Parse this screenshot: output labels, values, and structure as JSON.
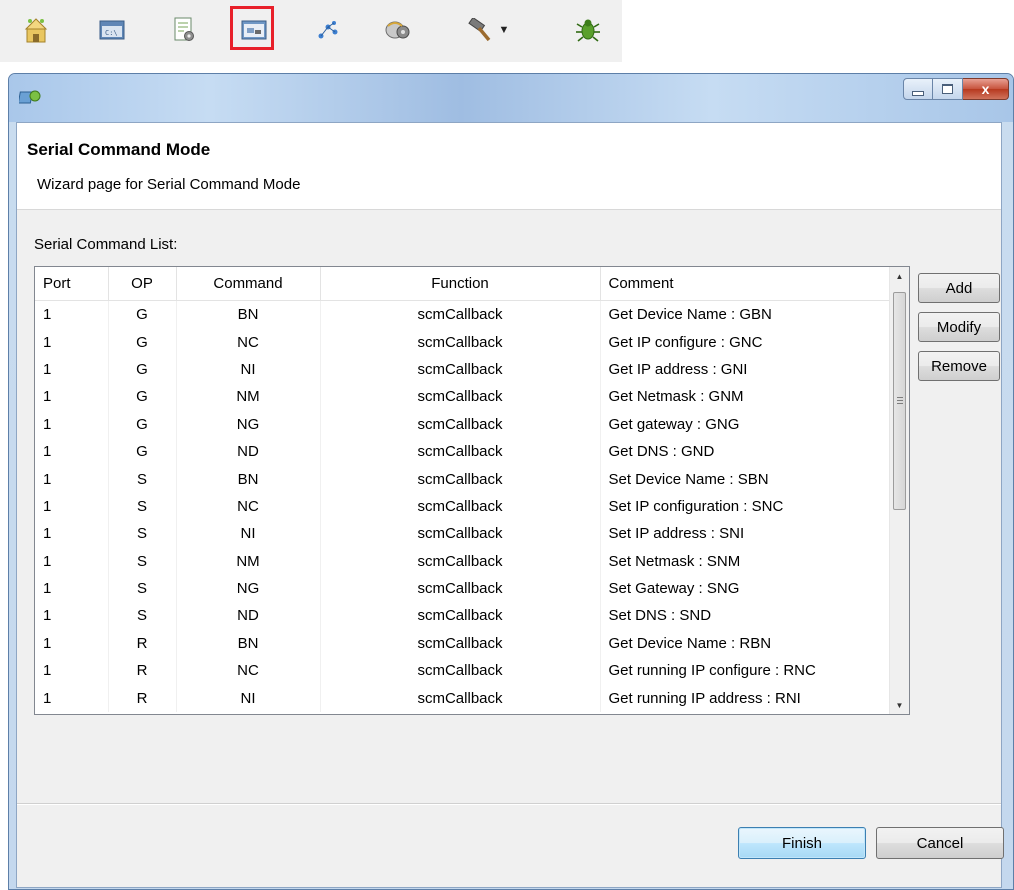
{
  "toolbar": {
    "buttons": [
      {
        "icon": "project-wizard-icon"
      },
      {
        "icon": "console-icon"
      },
      {
        "icon": "settings-document-icon"
      },
      {
        "icon": "serial-command-mode-icon",
        "selected": true
      },
      {
        "icon": "network-icon"
      },
      {
        "icon": "configure-icon"
      },
      {
        "icon": "build-hammer-icon"
      },
      {
        "icon": "debug-bug-icon"
      }
    ],
    "highlight_color": "#e8202a"
  },
  "window": {
    "caption": {
      "minimize": "–",
      "maximize": "□",
      "close": "x"
    }
  },
  "wizard": {
    "title": "Serial Command Mode",
    "description": "Wizard page for Serial Command Mode",
    "list_label": "Serial Command List:"
  },
  "table": {
    "columns": [
      "Port",
      "OP",
      "Command",
      "Function",
      "Comment"
    ],
    "rows": [
      [
        "1",
        "G",
        "BN",
        "scmCallback",
        "Get Device Name : GBN"
      ],
      [
        "1",
        "G",
        "NC",
        "scmCallback",
        "Get IP configure : GNC"
      ],
      [
        "1",
        "G",
        "NI",
        "scmCallback",
        "Get IP address : GNI"
      ],
      [
        "1",
        "G",
        "NM",
        "scmCallback",
        "Get Netmask : GNM"
      ],
      [
        "1",
        "G",
        "NG",
        "scmCallback",
        "Get gateway : GNG"
      ],
      [
        "1",
        "G",
        "ND",
        "scmCallback",
        "Get DNS : GND"
      ],
      [
        "1",
        "S",
        "BN",
        "scmCallback",
        "Set Device Name : SBN"
      ],
      [
        "1",
        "S",
        "NC",
        "scmCallback",
        "Set IP configuration : SNC"
      ],
      [
        "1",
        "S",
        "NI",
        "scmCallback",
        "Set IP address : SNI"
      ],
      [
        "1",
        "S",
        "NM",
        "scmCallback",
        "Set Netmask : SNM"
      ],
      [
        "1",
        "S",
        "NG",
        "scmCallback",
        "Set Gateway : SNG"
      ],
      [
        "1",
        "S",
        "ND",
        "scmCallback",
        "Set DNS : SND"
      ],
      [
        "1",
        "R",
        "BN",
        "scmCallback",
        "Get Device Name : RBN"
      ],
      [
        "1",
        "R",
        "NC",
        "scmCallback",
        "Get running IP configure : RNC"
      ],
      [
        "1",
        "R",
        "NI",
        "scmCallback",
        "Get running IP address : RNI"
      ]
    ]
  },
  "side_buttons": {
    "add": "Add",
    "modify": "Modify",
    "remove": "Remove"
  },
  "footer_buttons": {
    "finish": "Finish",
    "cancel": "Cancel"
  }
}
